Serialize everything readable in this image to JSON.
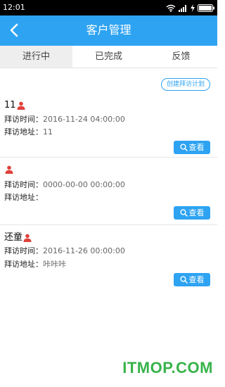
{
  "status_bar": {
    "time": "12:01",
    "icons": [
      "wifi-icon",
      "signal-icon",
      "charging-icon",
      "battery-icon"
    ]
  },
  "header": {
    "title": "客户管理",
    "back_icon": "chevron-left-icon"
  },
  "tabs": [
    {
      "label": "进行中",
      "active": true
    },
    {
      "label": "已完成",
      "active": false
    },
    {
      "label": "反馈",
      "active": false
    }
  ],
  "create_plan_label": "创建拜访计划",
  "visits": [
    {
      "name": "11",
      "time_label": "拜访时间：",
      "time_value": "2016-11-24 04:00:00",
      "address_label": "拜访地址：",
      "address_value": "11",
      "view_label": "查看"
    },
    {
      "name": "",
      "time_label": "拜访时间：",
      "time_value": "0000-00-00 00:00:00",
      "address_label": "拜访地址：",
      "address_value": "",
      "view_label": "查看"
    },
    {
      "name": "还童",
      "time_label": "拜访时间：",
      "time_value": "2016-11-26 00:00:00",
      "address_label": "拜访地址：",
      "address_value": "咔咔咔",
      "view_label": "查看"
    }
  ],
  "watermark": "ITMOP.COM",
  "colors": {
    "accent": "#2ea3f2",
    "person_icon": "#e0413b",
    "watermark": "#37b34a",
    "status_bar": "#000000"
  }
}
